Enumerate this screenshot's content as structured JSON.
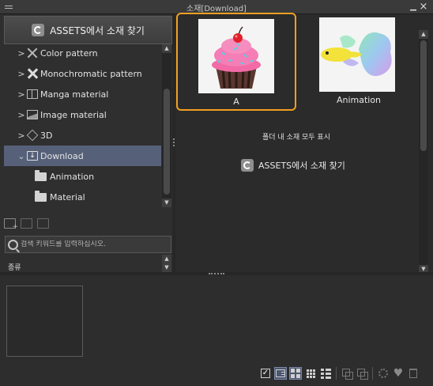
{
  "window": {
    "title": "소재[Download]"
  },
  "left": {
    "assets_button": "ASSETS에서 소재 찾기",
    "tree": [
      {
        "label": "Color pattern",
        "expanded": false
      },
      {
        "label": "Monochromatic pattern",
        "expanded": false
      },
      {
        "label": "Manga material",
        "expanded": false
      },
      {
        "label": "Image material",
        "expanded": false
      },
      {
        "label": "3D",
        "expanded": false
      },
      {
        "label": "Download",
        "expanded": true,
        "selected": true
      },
      {
        "label": "Animation"
      },
      {
        "label": "Material"
      }
    ],
    "search_placeholder": "검색 키워드를 입력하십시오.",
    "type_label": "종류"
  },
  "right": {
    "tiles": [
      {
        "label": "A",
        "selected": true
      },
      {
        "label": "Animation",
        "selected": false
      }
    ],
    "show_all_in_folder": "폴더 내 소재 모두 표시",
    "assets_link": "ASSETS에서 소재 찾기"
  },
  "colors": {
    "selection_border": "#f0a020",
    "tree_selected": "#566179"
  }
}
